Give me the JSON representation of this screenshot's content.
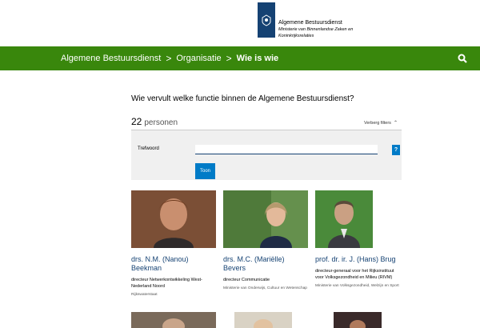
{
  "header": {
    "logo_line1": "Algemene Bestuursdienst",
    "logo_line2": "Ministerie van Binnenlandse Zaken en",
    "logo_line3": "Koninkrijksrelaties"
  },
  "breadcrumb": {
    "items": [
      "Algemene Bestuursdienst",
      "Organisatie"
    ],
    "current": "Wie is wie",
    "separator": ">"
  },
  "page": {
    "title": "Wie vervult welke functie binnen de Algemene Bestuursdienst?",
    "count": "22",
    "count_label": "personen",
    "toggle_label": "Verberg filters"
  },
  "filter": {
    "label": "Trefwoord",
    "value": "",
    "help": "?",
    "submit": "Toon"
  },
  "colors": {
    "green": "#39870c",
    "navy": "#154273",
    "blue": "#007bc7",
    "filter_bg": "#f0f0f0"
  },
  "people": [
    {
      "name": "drs. N.M. (Nanou) Beekman",
      "role": "directeur Netwerkontwikkeling West-Nederland Noord",
      "org": "Rijkswaterstaat"
    },
    {
      "name": "drs. M.C. (Mariëlle) Bevers",
      "role": "directeur Communicatie",
      "org": "Ministerie van Onderwijs, Cultuur en Wetenschap"
    },
    {
      "name": "prof. dr. ir. J. (Hans) Brug",
      "role": "directeur-generaal voor het Rijksinstituut voor Volksgezondheid en Milieu (RIVM)",
      "org": "Ministerie van Volksgezondheid, Welzijn en Sport"
    }
  ]
}
